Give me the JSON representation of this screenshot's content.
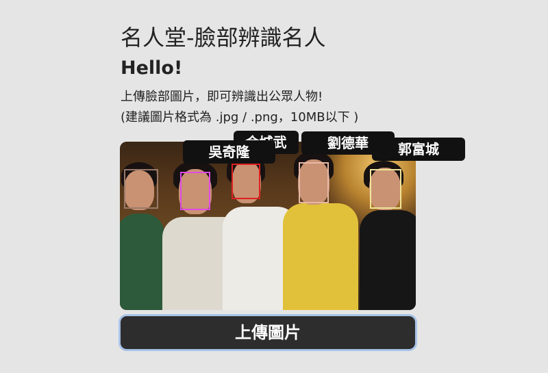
{
  "page": {
    "title": "名人堂-臉部辨識名人",
    "greeting": "Hello!",
    "description_line1": "上傳臉部圖片，即可辨識出公眾人物!",
    "description_line2": "(建議圖片格式為 .jpg / .png，10MB以下 )"
  },
  "photo": {
    "detections": [
      {
        "name": "",
        "color": "#9a7a6a"
      },
      {
        "name": "吳奇隆",
        "color": "#e04ae6"
      },
      {
        "name": "金城武",
        "color": "#e02020"
      },
      {
        "name": "劉德華",
        "color": "#e8b9a8"
      },
      {
        "name": "郭富城",
        "color": "#f2e59a"
      }
    ]
  },
  "upload_button": {
    "label": "上傳圖片"
  }
}
